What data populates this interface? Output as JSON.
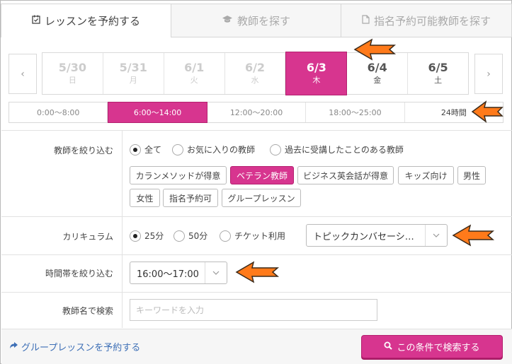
{
  "tabs": [
    {
      "label": "レッスンを予約する",
      "icon": "calendar-check-icon",
      "active": true
    },
    {
      "label": "教師を探す",
      "icon": "graduation-cap-icon",
      "active": false
    },
    {
      "label": "指名予約可能教師を探す",
      "icon": "document-icon",
      "active": false
    }
  ],
  "dates": [
    {
      "date": "5/30",
      "weekday": "日",
      "state": "past"
    },
    {
      "date": "5/31",
      "weekday": "月",
      "state": "past"
    },
    {
      "date": "6/1",
      "weekday": "火",
      "state": "past"
    },
    {
      "date": "6/2",
      "weekday": "水",
      "state": "past"
    },
    {
      "date": "6/3",
      "weekday": "木",
      "state": "selected"
    },
    {
      "date": "6/4",
      "weekday": "金",
      "state": "future"
    },
    {
      "date": "6/5",
      "weekday": "土",
      "state": "future"
    }
  ],
  "nav": {
    "prev": "‹",
    "next": "›"
  },
  "time_ranges": [
    {
      "label": "0:00〜8:00",
      "selected": false
    },
    {
      "label": "6:00〜14:00",
      "selected": true
    },
    {
      "label": "12:00〜20:00",
      "selected": false
    },
    {
      "label": "18:00〜25:00",
      "selected": false
    },
    {
      "label": "24時間",
      "selected": false
    }
  ],
  "teacher_filter": {
    "label": "教師を絞り込む",
    "radios": [
      {
        "label": "全て",
        "checked": true
      },
      {
        "label": "お気に入りの教師",
        "checked": false
      },
      {
        "label": "過去に受講したことのある教師",
        "checked": false
      }
    ],
    "chips": [
      {
        "label": "カランメソッドが得意",
        "on": false
      },
      {
        "label": "ベテラン教師",
        "on": true
      },
      {
        "label": "ビジネス英会話が得意",
        "on": false
      },
      {
        "label": "キッズ向け",
        "on": false
      },
      {
        "label": "男性",
        "on": false
      },
      {
        "label": "女性",
        "on": false
      },
      {
        "label": "指名予約可",
        "on": false
      },
      {
        "label": "グループレッスン",
        "on": false
      }
    ]
  },
  "curriculum": {
    "label": "カリキュラム",
    "radios": [
      {
        "label": "25分",
        "checked": true
      },
      {
        "label": "50分",
        "checked": false
      },
      {
        "label": "チケット利用",
        "checked": false
      }
    ],
    "select_value": "トピックカンバセーシ…"
  },
  "time_slot": {
    "label": "時間帯を絞り込む",
    "select_value": "16:00〜17:00"
  },
  "teacher_name": {
    "label": "教師名で検索",
    "placeholder": "キーワードを入力"
  },
  "footer": {
    "group_link": "グループレッスンを予約する",
    "search_button": "この条件で検索する"
  },
  "colors": {
    "accent": "#d7358f",
    "link": "#3d6fb6",
    "annotation_arrow": "#ff7a1a"
  }
}
